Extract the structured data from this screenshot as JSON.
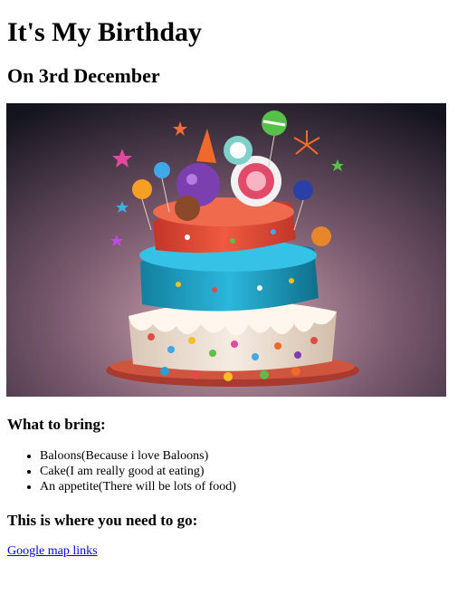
{
  "heading": {
    "title": "It's My Birthday",
    "subtitle": "On 3rd December"
  },
  "hero_image": {
    "icon": "birthday-cake-image",
    "colors": {
      "background_dark": "#1a1a24",
      "background_light": "#c7a3ae",
      "top_tier": "#e94a3c",
      "middle_tier": "#1fa6c9",
      "bottom_tier": "#f3e8dc",
      "plate": "#c8463a"
    }
  },
  "bring": {
    "heading": "What to bring:",
    "items": [
      "Baloons(Because i love Baloons)",
      "Cake(I am really good at eating)",
      "An appetite(There will be lots of food)"
    ]
  },
  "directions": {
    "heading": "This is where you need to go:",
    "link_text": "Google map links"
  }
}
